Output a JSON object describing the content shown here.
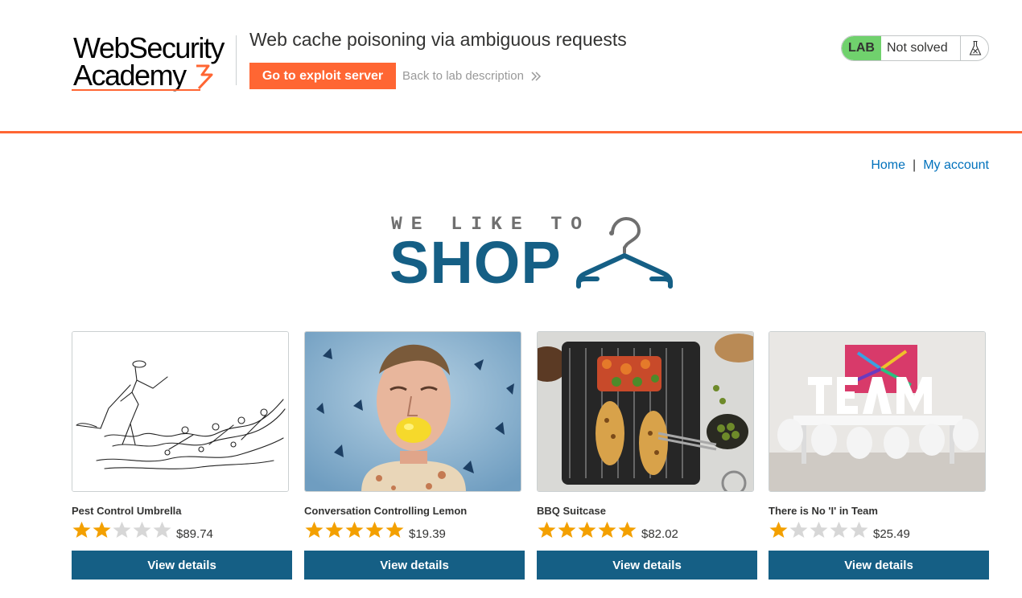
{
  "header": {
    "logo_line1": "WebSecurity",
    "logo_line2": "Academy",
    "lab_title": "Web cache poisoning via ambiguous requests",
    "exploit_button": "Go to exploit server",
    "back_link": "Back to lab description",
    "lab_badge": "LAB",
    "lab_status": "Not solved"
  },
  "nav": {
    "home": "Home",
    "separator": "|",
    "account": "My account"
  },
  "hero": {
    "small_text": "WE LIKE TO",
    "big_text": "SHOP"
  },
  "products": [
    {
      "name": "Pest Control Umbrella",
      "rating": 2,
      "price": "$89.74",
      "button": "View details"
    },
    {
      "name": "Conversation Controlling Lemon",
      "rating": 5,
      "price": "$19.39",
      "button": "View details"
    },
    {
      "name": "BBQ Suitcase",
      "rating": 5,
      "price": "$82.02",
      "button": "View details"
    },
    {
      "name": "There is No 'I' in Team",
      "rating": 1,
      "price": "$25.49",
      "button": "View details"
    }
  ],
  "colors": {
    "accent": "#ff6633",
    "primary": "#155f85",
    "link": "#0071bc",
    "star_on": "#f3a000",
    "star_off": "#d7d7d7",
    "lab_badge": "#70d16d"
  }
}
